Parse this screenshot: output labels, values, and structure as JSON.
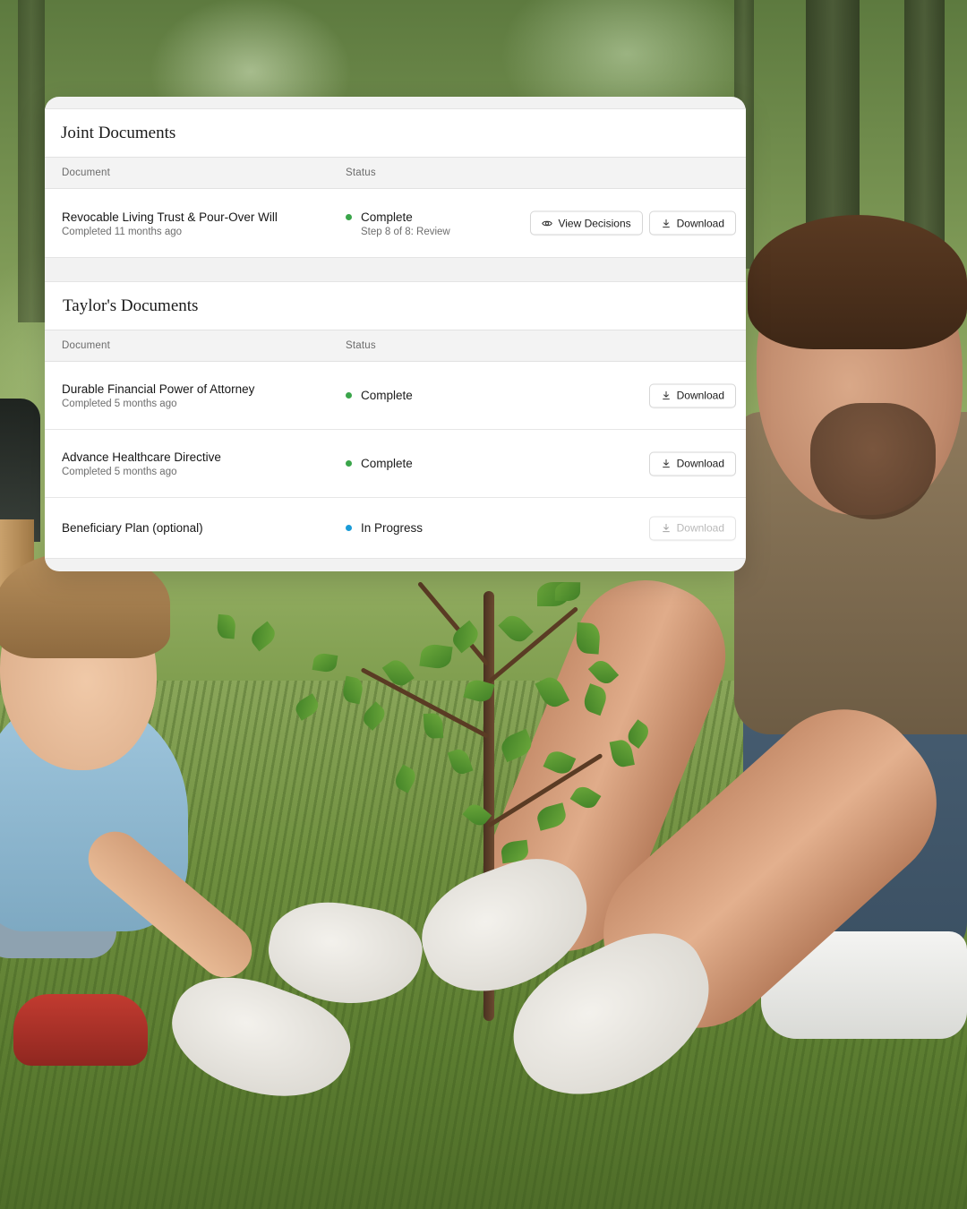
{
  "joint": {
    "title": "Joint Documents",
    "columns": {
      "document": "Document",
      "status": "Status"
    },
    "rows": [
      {
        "name": "Revocable Living Trust & Pour-Over Will",
        "sub": "Completed 11 months ago",
        "status": "Complete",
        "status_sub": "Step 8 of 8: Review",
        "view_label": "View Decisions",
        "download_label": "Download"
      }
    ]
  },
  "taylor": {
    "title": "Taylor's Documents",
    "columns": {
      "document": "Document",
      "status": "Status"
    },
    "rows": [
      {
        "name": "Durable Financial Power of Attorney",
        "sub": "Completed 5 months ago",
        "status": "Complete",
        "download_label": "Download"
      },
      {
        "name": "Advance Healthcare Directive",
        "sub": "Completed 5 months ago",
        "status": "Complete",
        "download_label": "Download"
      },
      {
        "name": "Beneficiary Plan (optional)",
        "status": "In Progress",
        "download_label": "Download"
      }
    ]
  },
  "colors": {
    "complete_dot": "#3aa54a",
    "in_progress_dot": "#1a9bd7"
  },
  "icons": {
    "view": "eye-icon",
    "download": "download-icon"
  }
}
